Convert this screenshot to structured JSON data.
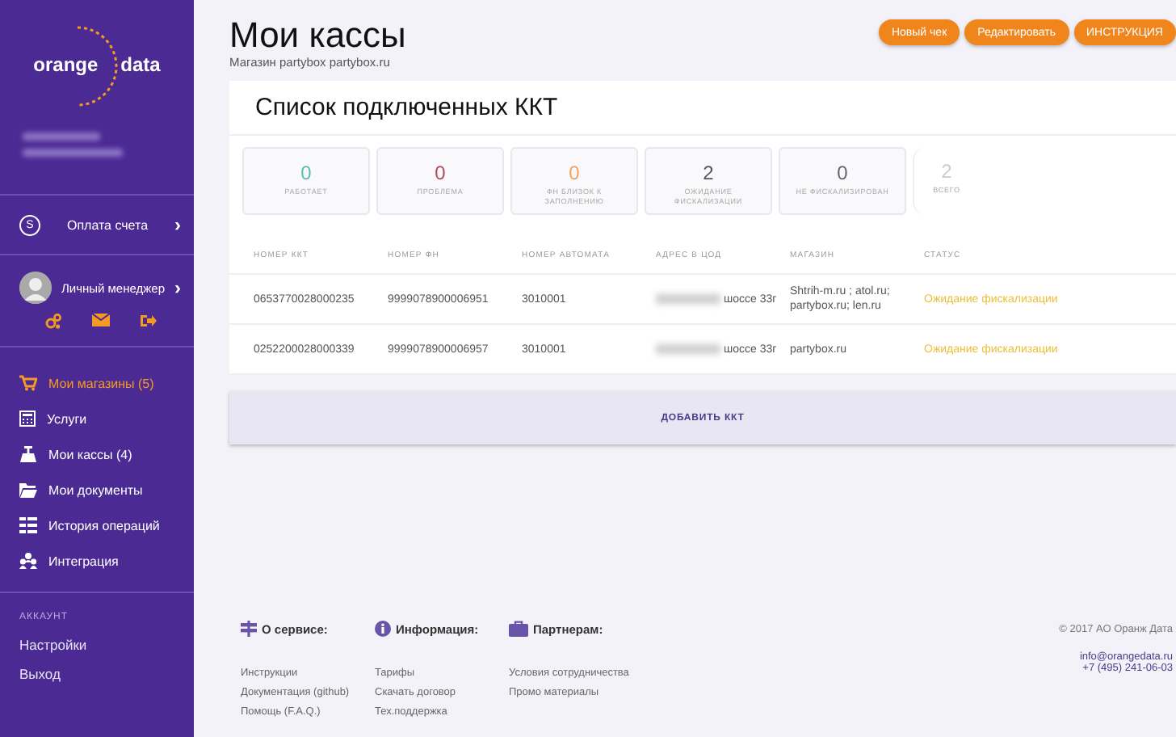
{
  "sidebar": {
    "logo": {
      "left": "orange",
      "right": "data"
    },
    "payment": {
      "icon_text": "S",
      "label": "Оплата счета",
      "arrow": "›"
    },
    "manager": {
      "label": "Личный менеджер",
      "arrow": "›"
    },
    "menu": [
      {
        "label": "Мои магазины (5)",
        "kind": "cart",
        "selected": true
      },
      {
        "label": "Услуги",
        "kind": "calculator",
        "selected": false
      },
      {
        "label": "Мои кассы (4)",
        "kind": "register",
        "selected": false
      },
      {
        "label": "Мои документы",
        "kind": "folder",
        "selected": false
      },
      {
        "label": "История операций",
        "kind": "list",
        "selected": false
      },
      {
        "label": "Интеграция",
        "kind": "people",
        "selected": false
      }
    ],
    "account": {
      "heading": "АККАУНТ",
      "items": [
        "Настройки",
        "Выход"
      ]
    }
  },
  "header": {
    "title": "Мои кассы",
    "subtitle": "Магазин partybox partybox.ru",
    "buttons": [
      "Новый чек",
      "Редактировать",
      "ИНСТРУКЦИЯ"
    ]
  },
  "card": {
    "title": "Список подключенных ККТ",
    "stats": [
      {
        "value": "0",
        "label": "РАБОТАЕТ",
        "color": "#5bbdaf"
      },
      {
        "value": "0",
        "label": "ПРОБЛЕМА",
        "color": "#b04a5e"
      },
      {
        "value": "0",
        "label": "ФН БЛИЗОК К ЗАПОЛНЕНИЮ",
        "color": "#f2a35e"
      },
      {
        "value": "2",
        "label": "ОЖИДАНИЕ ФИСКАЛИЗАЦИИ",
        "color": "#555555"
      },
      {
        "value": "0",
        "label": "НЕ ФИСКАЛИЗИРОВАН",
        "color": "#666666"
      }
    ],
    "total": {
      "value": "2",
      "label": "ВСЕГО"
    },
    "table": {
      "columns": [
        "НОМЕР ККТ",
        "НОМЕР ФН",
        "НОМЕР АВТОМАТА",
        "АДРЕС В ЦОД",
        "МАГАЗИН",
        "СТАТУС"
      ],
      "rows": [
        [
          "0653770028000235",
          "9999078900006951",
          "3010001",
          "шоссе 33г",
          "Shtrih-m.ru ; atol.ru; partybox.ru; len.ru",
          "Ожидание фискализации"
        ],
        [
          "0252200028000339",
          "9999078900006957",
          "3010001",
          "шоссе 33г",
          "partybox.ru",
          "Ожидание фискализации"
        ]
      ]
    },
    "add_button": "ДОБАВИТЬ ККТ"
  },
  "footer": {
    "columns": [
      {
        "heading": "О сервисе:",
        "kind": "signpost",
        "links": [
          "Инструкции",
          "Документация (github)",
          "Помощь (F.A.Q.)"
        ]
      },
      {
        "heading": "Информация:",
        "kind": "info",
        "links": [
          "Тарифы",
          "Скачать договор",
          "Тех.поддержка"
        ]
      },
      {
        "heading": "Партнерам:",
        "kind": "briefcase",
        "links": [
          "Условия сотрудничества",
          "Промо материалы"
        ]
      }
    ],
    "copyright": "© 2017 АО Оранж Дата",
    "email": "info@orangedata.ru",
    "phone": "+7 (495) 241-06-03"
  }
}
